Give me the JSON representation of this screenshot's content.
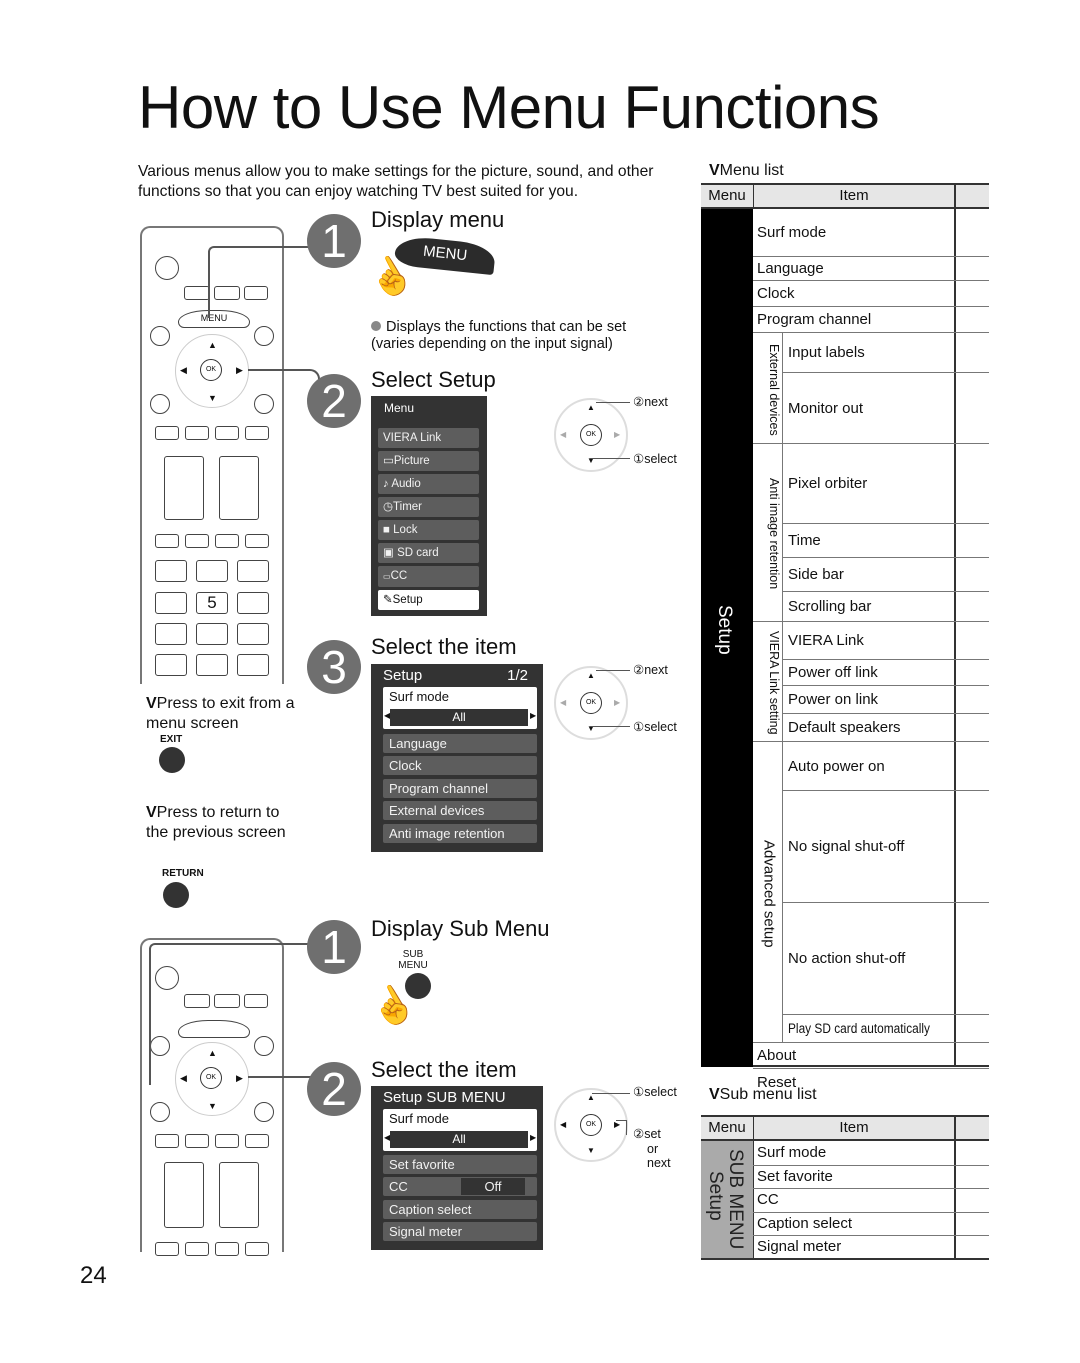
{
  "page": {
    "title": "How to Use Menu Functions",
    "intro": "Various menus allow you to make settings for the picture, sound, and other functions so that you can enjoy watching TV best suited for you.",
    "page_number": "24"
  },
  "steps_main": [
    {
      "number": "1",
      "title": "Display menu",
      "button_label": "MENU",
      "bullet": "Displays the functions that can be set (varies depending on the input signal)"
    },
    {
      "number": "2",
      "title": "Select  Setup",
      "next_label": "②next",
      "select_label": "①select"
    },
    {
      "number": "3",
      "title": "Select the item",
      "next_label": "②next",
      "select_label": "①select"
    }
  ],
  "steps_sub": [
    {
      "number": "1",
      "title": "Display Sub  Menu",
      "button_label_line1": "SUB",
      "button_label_line2": "MENU"
    },
    {
      "number": "2",
      "title": "Select the item",
      "select_label": "①select",
      "set_label": "②set",
      "or_label": "or",
      "next_label": "next"
    }
  ],
  "remote": {
    "menu_label": "MENU",
    "ok_label": "OK",
    "key_5": "5",
    "exit_note": "Press to exit from a menu screen",
    "exit_button": "EXIT",
    "return_note": "Press to return to the previous screen",
    "return_button": "RETURN",
    "bullet_marker": "V"
  },
  "osd_main_menu": {
    "title": "Menu",
    "items": [
      {
        "icon": "link-icon",
        "label": "VIERA Link"
      },
      {
        "icon": "picture-icon",
        "label": "Picture"
      },
      {
        "icon": "audio-icon",
        "label": "Audio"
      },
      {
        "icon": "timer-icon",
        "label": "Timer"
      },
      {
        "icon": "lock-icon",
        "label": "Lock"
      },
      {
        "icon": "sd-card-icon",
        "label": "SD card"
      },
      {
        "icon": "cc-icon",
        "label": "CC"
      },
      {
        "icon": "setup-icon",
        "label": "Setup",
        "selected": true
      }
    ]
  },
  "osd_setup": {
    "title": "Setup",
    "page": "1/2",
    "selected_item": "Surf mode",
    "selected_value": "All",
    "items": [
      "Language",
      "Clock",
      "Program channel",
      "External devices",
      "Anti image retention"
    ]
  },
  "osd_sub_menu": {
    "title": "Setup SUB MENU",
    "selected_item": "Surf mode",
    "selected_value": "All",
    "items": [
      {
        "label": "Set favorite"
      },
      {
        "label": "CC",
        "value": "Off"
      },
      {
        "label": "Caption select"
      },
      {
        "label": "Signal meter"
      }
    ]
  },
  "menu_list": {
    "heading": "Menu list",
    "col_menu": "Menu",
    "col_item": "Item",
    "menu_name": "Setup",
    "top_items": [
      "Surf mode",
      "Language",
      "Clock",
      "Program channel"
    ],
    "groups": [
      {
        "name": "External devices",
        "items": [
          "Input labels",
          "Monitor out"
        ]
      },
      {
        "name": "Anti image retention",
        "items": [
          "Pixel orbiter",
          "Time",
          "Side bar",
          "Scrolling bar"
        ]
      },
      {
        "name": "VIERA Link setting",
        "items": [
          "VIERA Link",
          "Power off link",
          "Power on link",
          "Default speakers"
        ]
      },
      {
        "name": "Advanced setup",
        "items": [
          "Auto power on",
          "No signal shut-off",
          "No action shut-off",
          "Play SD card automatically"
        ]
      }
    ],
    "bottom_items": [
      "About",
      "Reset"
    ]
  },
  "sub_menu_list": {
    "heading": "Sub menu list",
    "col_menu": "Menu",
    "col_item": "Item",
    "menu_name_line1": "Setup",
    "menu_name_line2": "SUB MENU",
    "items": [
      "Surf mode",
      "Set favorite",
      "CC",
      "Caption select",
      "Signal meter"
    ]
  }
}
